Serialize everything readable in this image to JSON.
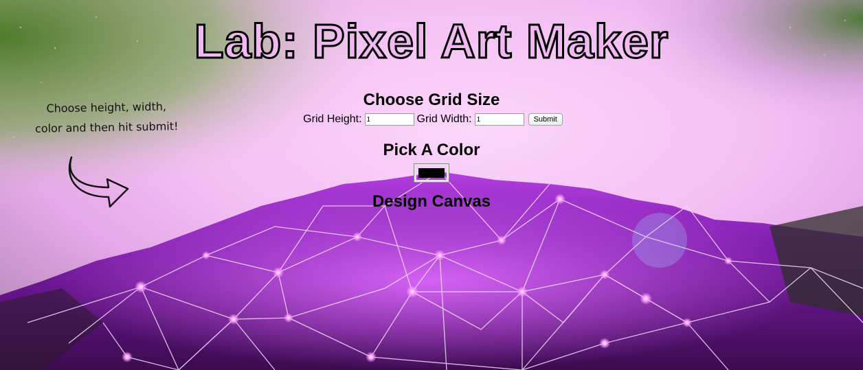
{
  "page": {
    "title": "Lab: Pixel Art Maker"
  },
  "hint": {
    "line1": "Choose height, width,",
    "line2": "color and then hit submit!"
  },
  "grid": {
    "heading": "Choose Grid Size",
    "height_label": "Grid Height:",
    "height_value": "1",
    "width_label": "Grid Width:",
    "width_value": "1",
    "submit_label": "Submit"
  },
  "color": {
    "heading": "Pick A Color",
    "value": "#000000"
  },
  "canvas": {
    "heading": "Design Canvas"
  },
  "theme": {
    "background_top": "#f6c4f5",
    "background_glow_green": "#6aa03a",
    "mesh_purple": "#8a1fc0",
    "mesh_lines": "#f4d8ff"
  }
}
